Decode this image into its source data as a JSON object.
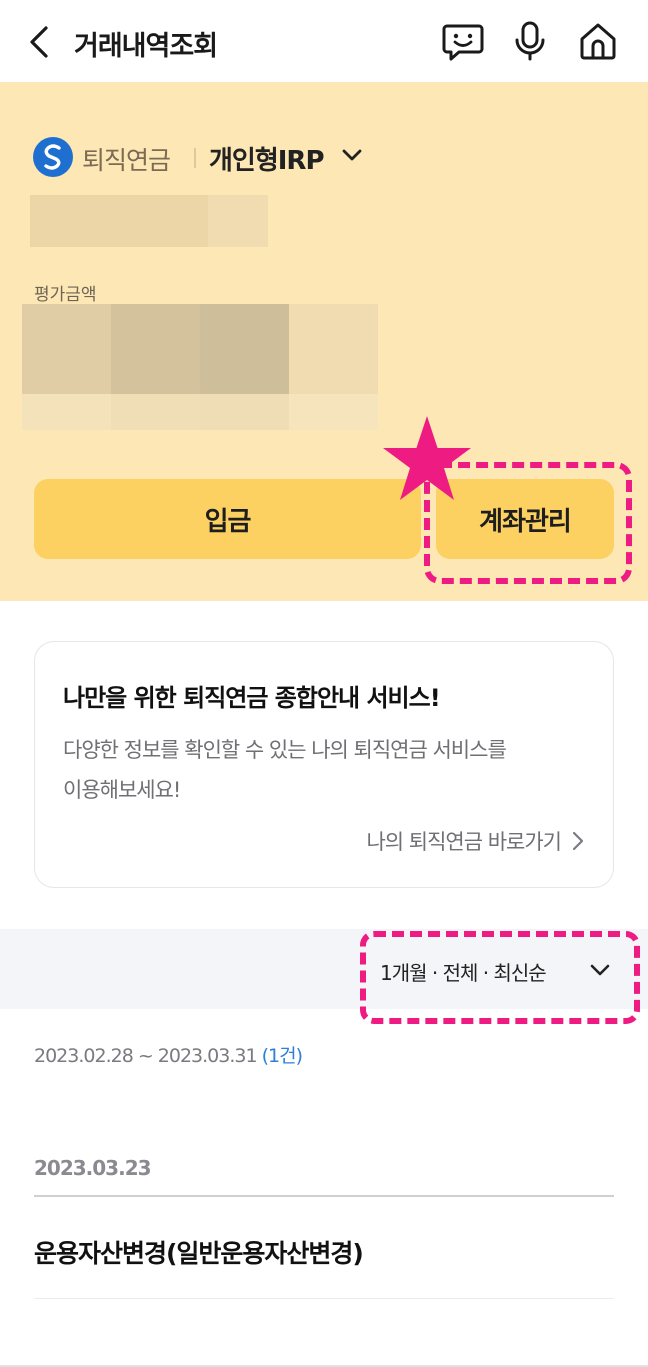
{
  "header": {
    "title": "거래내역조회",
    "icons": [
      "back-icon",
      "chatbot-icon",
      "microphone-icon",
      "home-icon"
    ]
  },
  "account": {
    "brand": "퇴직연금",
    "type": "개인형IRP",
    "eval_label": "평가금액",
    "deposit_label": "입금",
    "manage_label": "계좌관리"
  },
  "info_card": {
    "title": "나만을 위한 퇴직연금 종합안내 서비스!",
    "desc_line1": "다양한 정보를 확인할 수 있는 나의 퇴직연금 서비스를",
    "desc_line2": "이용해보세요!",
    "link": "나의 퇴직연금 바로가기"
  },
  "filter": {
    "label": "1개월 · 전체 · 최신순"
  },
  "range": {
    "period": "2023.02.28 ~ 2023.03.31",
    "count": "(1건)"
  },
  "transactions": [
    {
      "date": "2023.03.23",
      "title": "운용자산변경(일반운용자산변경)"
    }
  ],
  "colors": {
    "panel_bg": "#fde8b5",
    "button_bg": "#fdd062",
    "highlight": "#ee1c82",
    "link_blue": "#2f7fd6"
  }
}
